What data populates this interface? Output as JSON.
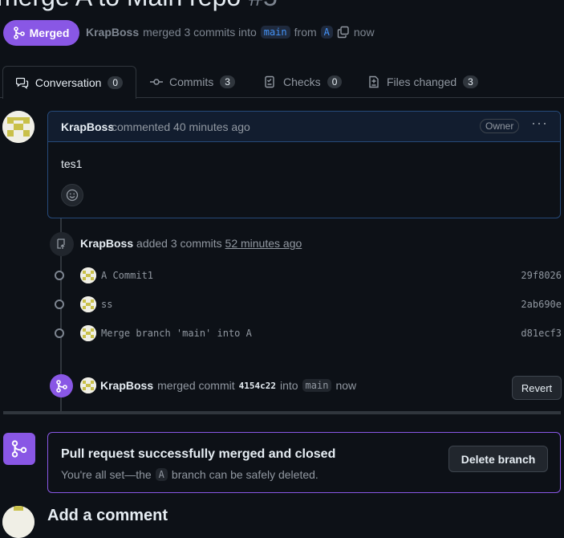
{
  "pr": {
    "title": "merge A to Main repo",
    "number": "#5",
    "status": "Merged",
    "author": "KrapBoss",
    "merged_text": "merged 3 commits into",
    "base_branch": "main",
    "from_text": "from",
    "head_branch": "A",
    "time": "now"
  },
  "tabs": [
    {
      "label": "Conversation",
      "count": "0"
    },
    {
      "label": "Commits",
      "count": "3"
    },
    {
      "label": "Checks",
      "count": "0"
    },
    {
      "label": "Files changed",
      "count": "3"
    }
  ],
  "comment": {
    "author": "KrapBoss",
    "action": "commented 40 minutes ago",
    "role": "Owner",
    "body": "tes1"
  },
  "commits_event": {
    "author": "KrapBoss",
    "action": "added 3 commits",
    "time": "52 minutes ago",
    "commits": [
      {
        "message": "A Commit1",
        "sha": "29f8026"
      },
      {
        "message": "ss",
        "sha": "2ab690e"
      },
      {
        "message": "Merge branch 'main' into A",
        "sha": "d81ecf3"
      }
    ]
  },
  "merge_event": {
    "author": "KrapBoss",
    "action": "merged commit",
    "sha": "4154c22",
    "into": "into",
    "branch": "main",
    "time": "now",
    "revert_label": "Revert"
  },
  "merged_box": {
    "title": "Pull request successfully merged and closed",
    "desc_before": "You're all set—the",
    "branch": "A",
    "desc_after": "branch can be safely deleted.",
    "delete_label": "Delete branch"
  },
  "footer": {
    "add_comment_title": "Add a comment"
  },
  "colors": {
    "merged": "#8957e5",
    "link": "#4493f8",
    "bg": "#0d1117"
  }
}
